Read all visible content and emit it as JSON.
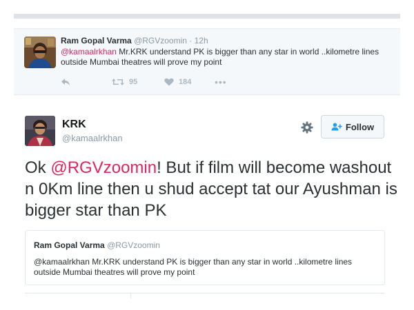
{
  "reply_tweet": {
    "author_name": "Ram Gopal Varma",
    "handle": "@RGVzoomin",
    "separator": " · ",
    "time": "12h",
    "mention": "@kamaalrkhan",
    "text": " Mr.KRK understand PK is bigger than any star in world ..kilometre lines outside Mumbai theatres will prove my point",
    "retweet_count": "95",
    "like_count": "184",
    "more_label": "•••"
  },
  "main_tweet": {
    "author_name": "KRK",
    "handle": "@kamaalrkhan",
    "follow_label": "Follow",
    "text_prefix": "Ok ",
    "mention": "@RGVzoomin",
    "text_suffix": "! But if film will become washout n 0Km line then u shud accept tat our Ayushman is bigger star than PK"
  },
  "quoted_tweet": {
    "author_name": "Ram Gopal Varma",
    "handle": "@RGVzoomin",
    "text": "@kamaalrkhan Mr.KRK understand PK is bigger than any star in world ..kilometre lines outside Mumbai theatres will prove my point"
  },
  "colors": {
    "mention": "#e0245e",
    "follow_icon": "#1da1f2",
    "muted": "#8899a6"
  }
}
